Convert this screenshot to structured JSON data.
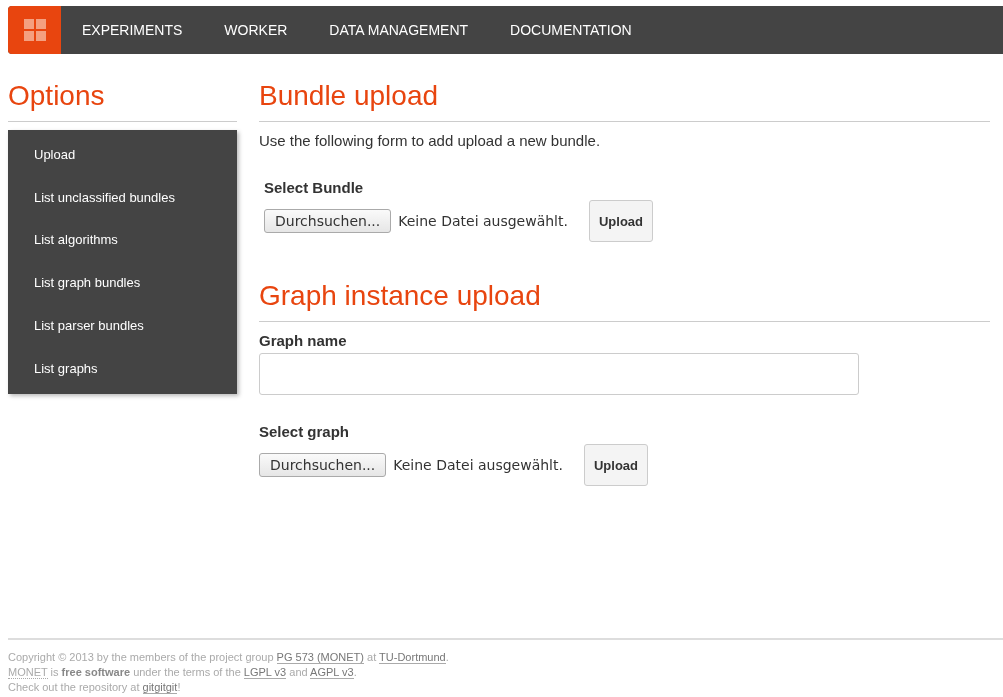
{
  "navbar": {
    "items": [
      {
        "label": "EXPERIMENTS"
      },
      {
        "label": "WORKER"
      },
      {
        "label": "DATA MANAGEMENT"
      },
      {
        "label": "DOCUMENTATION"
      }
    ]
  },
  "sidebar": {
    "title": "Options",
    "items": [
      {
        "label": "Upload"
      },
      {
        "label": "List unclassified bundles"
      },
      {
        "label": "List algorithms"
      },
      {
        "label": "List graph bundles"
      },
      {
        "label": "List parser bundles"
      },
      {
        "label": "List graphs"
      }
    ]
  },
  "bundle_upload": {
    "title": "Bundle upload",
    "intro": "Use the following form to add upload a new bundle.",
    "file_label": "Select Bundle",
    "browse_button": "Durchsuchen...",
    "file_status": "Keine Datei ausgewählt.",
    "upload_button": "Upload"
  },
  "graph_upload": {
    "title": "Graph instance upload",
    "name_label": "Graph name",
    "file_label": "Select graph",
    "browse_button": "Durchsuchen...",
    "file_status": "Keine Datei ausgewählt.",
    "upload_button": "Upload"
  },
  "footer": {
    "lines": [
      [
        {
          "kind": "text",
          "text": "Copyright © 2013 by the members of the project group "
        },
        {
          "kind": "link",
          "text": "PG 573 (MONET)"
        },
        {
          "kind": "text",
          "text": " at "
        },
        {
          "kind": "link",
          "text": "TU-Dortmund"
        },
        {
          "kind": "text",
          "text": "."
        }
      ],
      [
        {
          "kind": "abbr",
          "text": "MONET"
        },
        {
          "kind": "text",
          "text": " is "
        },
        {
          "kind": "bold",
          "text": "free software"
        },
        {
          "kind": "text",
          "text": " under the terms of the "
        },
        {
          "kind": "link",
          "text": "LGPL v3"
        },
        {
          "kind": "text",
          "text": " and "
        },
        {
          "kind": "link",
          "text": "AGPL v3"
        },
        {
          "kind": "text",
          "text": "."
        }
      ],
      [
        {
          "kind": "text",
          "text": "Check out the repository at "
        },
        {
          "kind": "link",
          "text": "gitgitgit"
        },
        {
          "kind": "text",
          "text": "!"
        }
      ]
    ]
  }
}
